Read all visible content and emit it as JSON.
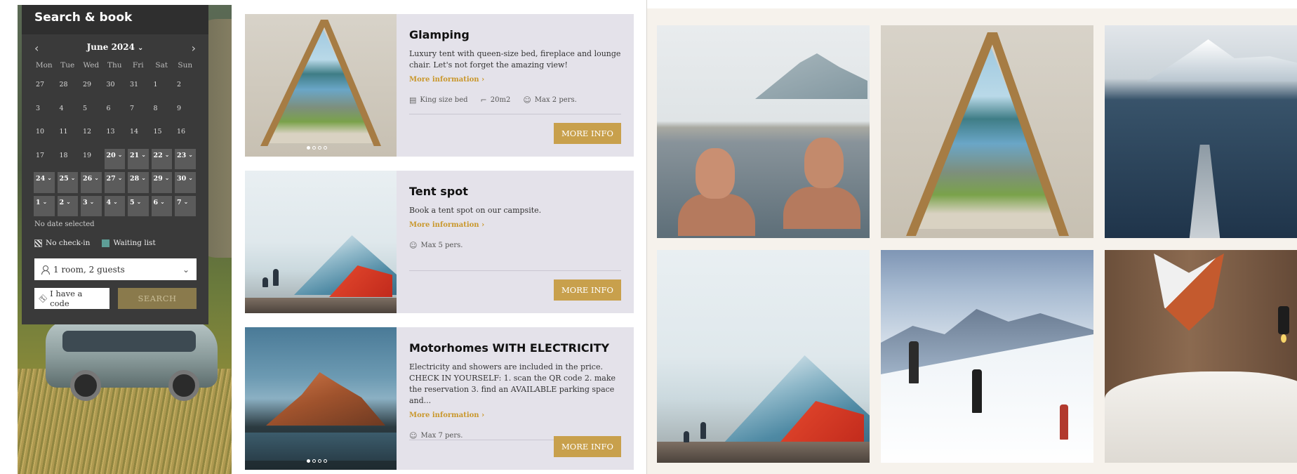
{
  "booking": {
    "title": "Search & book",
    "month_label": "June 2024",
    "prev_icon": "chevron-left-icon",
    "next_icon": "chevron-right-icon",
    "weekdays": [
      "Mon",
      "Tue",
      "Wed",
      "Thu",
      "Fri",
      "Sat",
      "Sun"
    ],
    "weeks": [
      [
        {
          "d": "27",
          "s": false
        },
        {
          "d": "28",
          "s": false
        },
        {
          "d": "29",
          "s": false
        },
        {
          "d": "30",
          "s": false
        },
        {
          "d": "31",
          "s": false
        },
        {
          "d": "1",
          "s": false
        },
        {
          "d": "2",
          "s": false
        }
      ],
      [
        {
          "d": "3",
          "s": false
        },
        {
          "d": "4",
          "s": false
        },
        {
          "d": "5",
          "s": false
        },
        {
          "d": "6",
          "s": false
        },
        {
          "d": "7",
          "s": false
        },
        {
          "d": "8",
          "s": false
        },
        {
          "d": "9",
          "s": false
        }
      ],
      [
        {
          "d": "10",
          "s": false
        },
        {
          "d": "11",
          "s": false
        },
        {
          "d": "12",
          "s": false
        },
        {
          "d": "13",
          "s": false
        },
        {
          "d": "14",
          "s": false
        },
        {
          "d": "15",
          "s": false
        },
        {
          "d": "16",
          "s": false
        }
      ],
      [
        {
          "d": "17",
          "s": false
        },
        {
          "d": "18",
          "s": false
        },
        {
          "d": "19",
          "s": false
        },
        {
          "d": "20",
          "s": true
        },
        {
          "d": "21",
          "s": true
        },
        {
          "d": "22",
          "s": true
        },
        {
          "d": "23",
          "s": true
        }
      ],
      [
        {
          "d": "24",
          "s": true
        },
        {
          "d": "25",
          "s": true
        },
        {
          "d": "26",
          "s": true
        },
        {
          "d": "27",
          "s": true
        },
        {
          "d": "28",
          "s": true
        },
        {
          "d": "29",
          "s": true
        },
        {
          "d": "30",
          "s": true
        }
      ],
      [
        {
          "d": "1",
          "s": true
        },
        {
          "d": "2",
          "s": true
        },
        {
          "d": "3",
          "s": true
        },
        {
          "d": "4",
          "s": true
        },
        {
          "d": "5",
          "s": true
        },
        {
          "d": "6",
          "s": true
        },
        {
          "d": "7",
          "s": true
        }
      ]
    ],
    "no_date": "No date selected",
    "legend_no_checkin": "No check-in",
    "legend_waiting": "Waiting list",
    "rooms_value": "1 room, 2 guests",
    "code_label": "I have a code",
    "search_label": "SEARCH"
  },
  "cards": [
    {
      "title": "Glamping",
      "description": "Luxury tent with queen-size bed, fireplace and lounge chair. Let's not forget the amazing view!",
      "more": "More information",
      "features": [
        {
          "icon": "bed-icon",
          "glyph": "▤",
          "label": "King size bed"
        },
        {
          "icon": "area-icon",
          "glyph": "⌐",
          "label": "20m2"
        },
        {
          "icon": "guests-icon",
          "glyph": "☺",
          "label": "Max 2 pers."
        }
      ],
      "button": "MORE INFO",
      "image": "tent"
    },
    {
      "title": "Tent spot",
      "description": "Book a tent spot on our campsite.",
      "more": "More information",
      "features": [
        {
          "icon": "guests-icon",
          "glyph": "☺",
          "label": "Max 5 pers."
        }
      ],
      "button": "MORE INFO",
      "image": "snow"
    },
    {
      "title": "Motorhomes WITH ELECTRICITY",
      "description": "Electricity and showers are included in the price. CHECK IN YOURSELF: 1. scan the QR code 2. make the reservation 3. find an AVAILABLE parking space and...",
      "more": "More information",
      "features": [
        {
          "icon": "guests-icon",
          "glyph": "☺",
          "label": "Max 7 pers."
        }
      ],
      "button": "MORE INFO",
      "image": "motorhome"
    }
  ],
  "colors": {
    "accent": "#c8a04c",
    "link": "#c9972b",
    "widget_bg": "#3a3a3a",
    "card_bg": "#e4e2ea",
    "waiting_list": "#5e9e97"
  }
}
